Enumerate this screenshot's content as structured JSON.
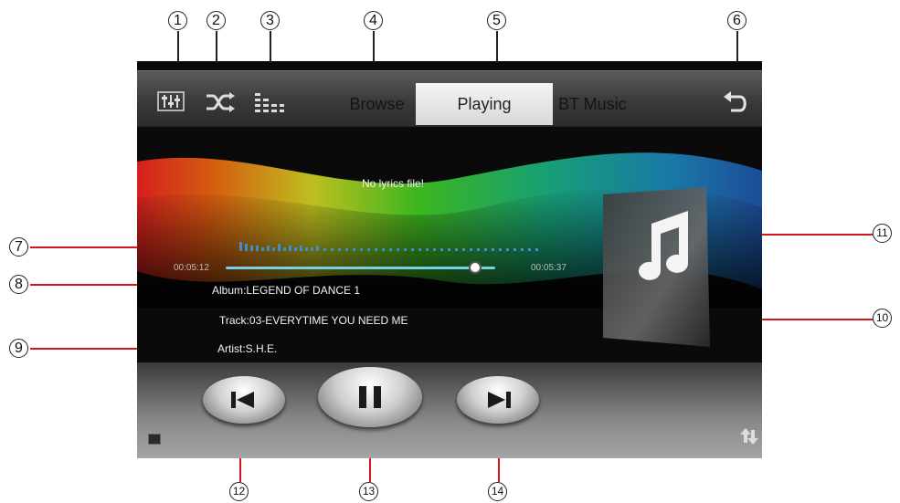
{
  "tabs": [
    {
      "label": "Browse"
    },
    {
      "label": "Playing"
    },
    {
      "label": "BT Music"
    }
  ],
  "icons": {
    "eq": "equalizer-icon",
    "shuffle": "shuffle-icon",
    "spectrum": "spectrum-icon",
    "back": "back-icon",
    "prev": "previous-track-icon",
    "pause": "pause-icon",
    "next": "next-track-icon",
    "album_art": "music-note-icon"
  },
  "player": {
    "lyrics_status": "No lyrics file!",
    "elapsed": "00:05:12",
    "total": "00:05:37",
    "progress": 0.926,
    "album": "Album:LEGEND OF DANCE 1",
    "track": "Track:03-EVERYTIME YOU NEED ME",
    "artist": "Artist:S.H.E."
  },
  "callouts": {
    "c1": "1",
    "c2": "2",
    "c3": "3",
    "c4": "4",
    "c5": "5",
    "c6": "6",
    "c7": "7",
    "c8": "8",
    "c9": "9",
    "c10": "10",
    "c11": "11",
    "c12": "12",
    "c13": "13",
    "c14": "14"
  },
  "colors": {
    "progress": "#79d0e4",
    "callout_line": "#d2161e",
    "tab_active_bg": "#e6e6e6"
  }
}
